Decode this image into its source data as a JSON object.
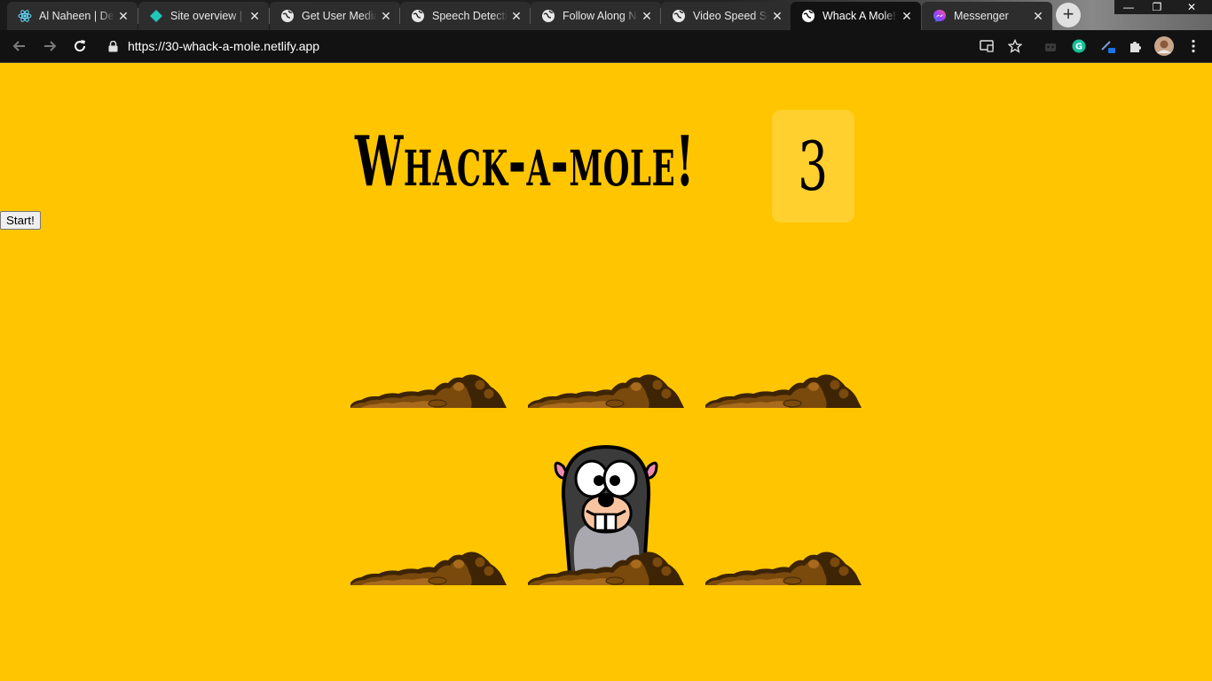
{
  "browser": {
    "tabs": [
      {
        "title": "Al Naheen | Dev",
        "favicon": "react-icon",
        "active": false
      },
      {
        "title": "Site overview | ",
        "favicon": "netlify-icon",
        "active": false
      },
      {
        "title": "Get User Media",
        "favicon": "globe-icon",
        "active": false
      },
      {
        "title": "Speech Detection",
        "favicon": "globe-icon",
        "active": false
      },
      {
        "title": "Follow Along N",
        "favicon": "globe-icon",
        "active": false
      },
      {
        "title": "Video Speed Sc",
        "favicon": "globe-icon",
        "active": false
      },
      {
        "title": "Whack A Mole!",
        "favicon": "globe-icon",
        "active": true
      },
      {
        "title": "Messenger",
        "favicon": "messenger-icon",
        "active": false
      }
    ],
    "tab_close_glyph": "✕",
    "new_tab_glyph": "+",
    "window_controls": {
      "minimize": "—",
      "restore": "❐",
      "close": "✕"
    },
    "url": "https://30-whack-a-mole.netlify.app",
    "toolbar_icons": [
      "back-icon",
      "forward-icon",
      "reload-icon",
      "lock-icon",
      "cast-icon",
      "star-icon",
      "extension-icon",
      "grammarly-icon",
      "pen-icon",
      "puzzle-icon",
      "avatar",
      "menu-icon"
    ]
  },
  "game": {
    "start_label": "Start!",
    "title": "Whack-a-mole!",
    "score": "3",
    "holes": [
      {
        "id": 1,
        "mole_up": false
      },
      {
        "id": 2,
        "mole_up": false
      },
      {
        "id": 3,
        "mole_up": false
      },
      {
        "id": 4,
        "mole_up": false
      },
      {
        "id": 5,
        "mole_up": true
      },
      {
        "id": 6,
        "mole_up": false
      }
    ]
  },
  "colors": {
    "page_background": "#ffc600",
    "dirt_dark": "#3d2405",
    "dirt_mid": "#7a4a0c",
    "dirt_light": "#a86a1c"
  }
}
